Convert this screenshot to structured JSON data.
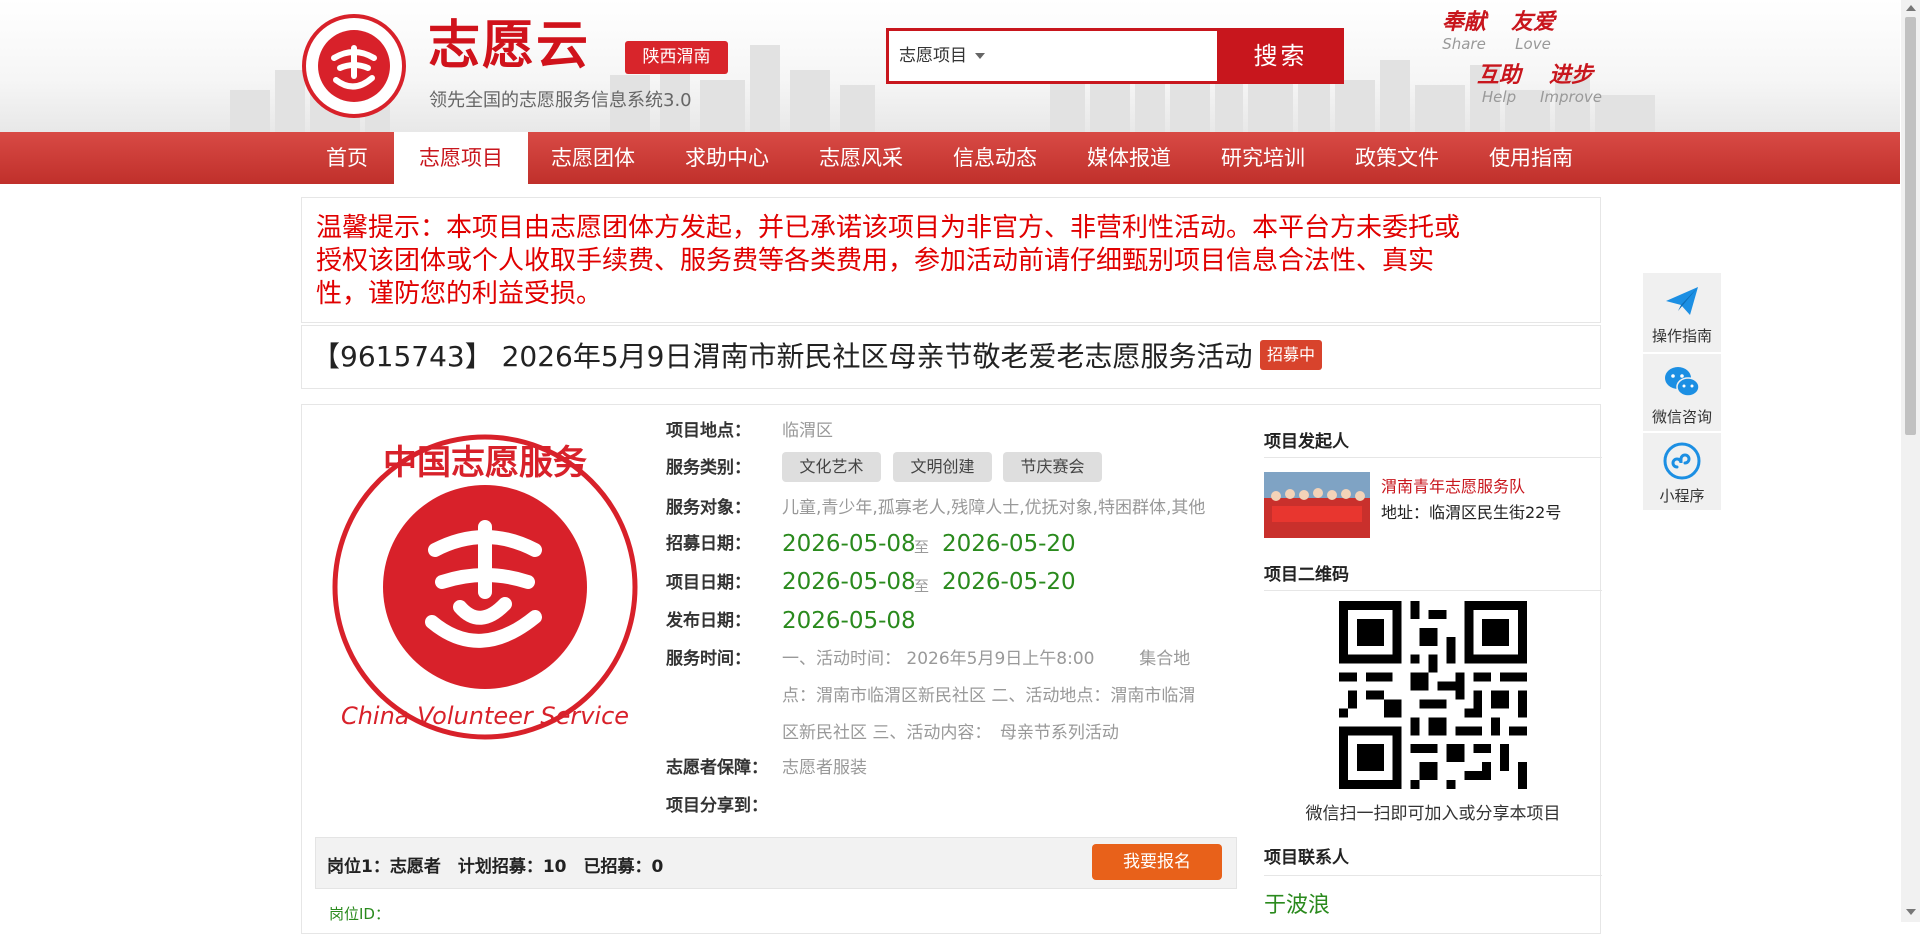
{
  "header": {
    "brand": "志愿云",
    "logo_text": "中国志愿服务 China Volunteer Service",
    "region": "陕西渭南",
    "slogan": "领先全国的志愿服务信息系统3.0",
    "search": {
      "category": "志愿项目",
      "placeholder": "",
      "button": "搜索"
    },
    "mottos": [
      {
        "cn": "奉献",
        "en": "Share"
      },
      {
        "cn": "友爱",
        "en": "Love"
      },
      {
        "cn": "互助",
        "en": "Help"
      },
      {
        "cn": "进步",
        "en": "Improve"
      }
    ]
  },
  "nav": {
    "items": [
      "首页",
      "志愿项目",
      "志愿团体",
      "求助中心",
      "志愿风采",
      "信息动态",
      "媒体报道",
      "研究培训",
      "政策文件",
      "使用指南"
    ],
    "active_index": 1
  },
  "notice": {
    "lines": [
      "温馨提示：本项目由志愿团体方发起，并已承诺该项目为非官方、非营利性活动。本平台方未委托或",
      "授权该团体或个人收取手续费、服务费等各类费用，参加活动前请仔细甄别项目信息合法性、真实",
      "性，谨防您的利益受损。"
    ]
  },
  "project": {
    "title": "【9615743】 2026年5月9日渭南市新民社区母亲节敬老爱老志愿服务活动",
    "status": "招募中",
    "fields": {
      "location_label": "项目地点：",
      "location": "临渭区",
      "category_label": "服务类别：",
      "categories": [
        "文化艺术",
        "文明创建",
        "节庆赛会"
      ],
      "target_label": "服务对象：",
      "target": "儿童,青少年,孤寡老人,残障人士,优抚对象,特困群体,其他",
      "recruit_label": "招募日期：",
      "recruit_start": "2026-05-08",
      "recruit_end": "2026-05-20",
      "project_label": "项目日期：",
      "project_start": "2026-05-08",
      "project_end": "2026-05-20",
      "publish_label": "发布日期：",
      "publish": "2026-05-08",
      "to": "至",
      "service_time_label": "服务时间：",
      "service_time_lines": [
        "一、活动时间： 2026年5月9日上午8:00 　　 集合地",
        "点：渭南市临渭区新民社区 二、活动地点：渭南市临渭",
        "区新民社区 三、活动内容：　母亲节系列活动"
      ],
      "guarantee_label": "志愿者保障：",
      "guarantee": "志愿者服装",
      "share_label": "项目分享到："
    },
    "post": {
      "info": "岗位1：志愿者　计划招募：10　已招募：0",
      "signup": "我要报名",
      "id_label": "岗位ID："
    }
  },
  "sidebar": {
    "initiator_title": "项目发起人",
    "team_name": "渭南青年志愿服务队",
    "team_address": "地址：临渭区民生街22号",
    "qr_title": "项目二维码",
    "qr_caption": "微信扫一扫即可加入或分享本项目",
    "contact_title": "项目联系人",
    "contact_name": "于波浪"
  },
  "float_bar": {
    "items": [
      {
        "label": "操作指南",
        "icon": "paper-plane-icon"
      },
      {
        "label": "微信咨询",
        "icon": "wechat-icon"
      },
      {
        "label": "小程序",
        "icon": "mini-program-icon"
      }
    ]
  },
  "colors": {
    "brand_red": "#c8161d",
    "nav_red": "#d0393a",
    "date_green": "#2a8a1d",
    "signup_orange": "#e8611a"
  }
}
